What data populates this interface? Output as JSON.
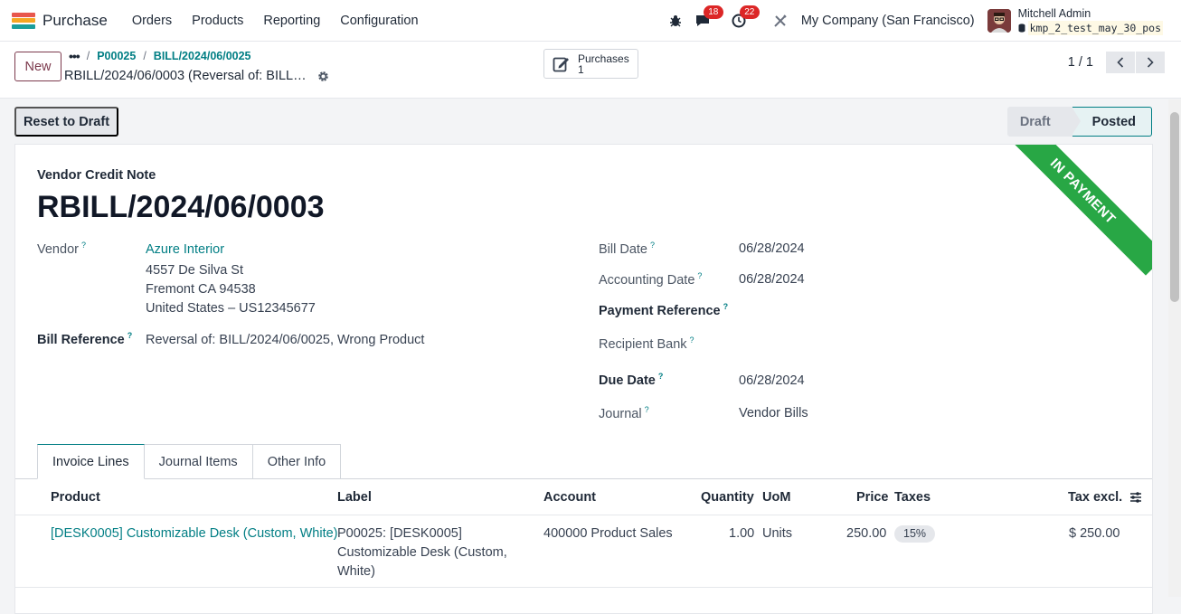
{
  "app": {
    "name": "Purchase",
    "logo_colors": [
      "#e8574d",
      "#f5a623",
      "#1a9e9b"
    ]
  },
  "menu": {
    "orders": "Orders",
    "products": "Products",
    "reporting": "Reporting",
    "configuration": "Configuration"
  },
  "systray": {
    "messages_count": "18",
    "activities_count": "22",
    "company": "My Company (San Francisco)",
    "user_name": "Mitchell Admin",
    "database": "kmp_2_test_may_30_pos"
  },
  "control_panel": {
    "new_label": "New",
    "breadcrumb": [
      "P00025",
      "BILL/2024/06/0025"
    ],
    "record_title": "RBILL/2024/06/0003 (Reversal of: BILL…",
    "smart_button": {
      "label": "Purchases",
      "count": "1"
    },
    "pager": "1 / 1"
  },
  "status": {
    "reset_label": "Reset to Draft",
    "stages": [
      "Draft",
      "Posted"
    ],
    "current": "Posted"
  },
  "form": {
    "ribbon": "IN PAYMENT",
    "doc_type": "Vendor Credit Note",
    "doc_name": "RBILL/2024/06/0003",
    "vendor_label": "Vendor",
    "vendor": "Azure Interior",
    "address": [
      "4557 De Silva St",
      "Fremont CA 94538",
      "United States – US12345677"
    ],
    "bill_reference_label": "Bill Reference",
    "bill_reference": "Reversal of: BILL/2024/06/0025, Wrong Product",
    "bill_date_label": "Bill Date",
    "bill_date": "06/28/2024",
    "accounting_date_label": "Accounting Date",
    "accounting_date": "06/28/2024",
    "payment_reference_label": "Payment Reference",
    "recipient_bank_label": "Recipient Bank",
    "due_date_label": "Due Date",
    "due_date": "06/28/2024",
    "journal_label": "Journal",
    "journal": "Vendor Bills",
    "help_mark": "?"
  },
  "tabs": [
    "Invoice Lines",
    "Journal Items",
    "Other Info"
  ],
  "lines": {
    "headers": {
      "product": "Product",
      "label": "Label",
      "account": "Account",
      "quantity": "Quantity",
      "uom": "UoM",
      "price": "Price",
      "taxes": "Taxes",
      "tax_excl": "Tax excl."
    },
    "rows": [
      {
        "product": "[DESK0005] Customizable Desk (Custom, White)",
        "label": [
          "P00025: [DESK0005]",
          "Customizable Desk (Custom,",
          "White)"
        ],
        "account": "400000 Product Sales",
        "quantity": "1.00",
        "uom": "Units",
        "price": "250.00",
        "tax": "15%",
        "subtotal": "$ 250.00"
      }
    ]
  },
  "colors": {
    "primary": "#7c3a4d",
    "link": "#017e84",
    "ribbon": "#28a745",
    "badge": "#dc2626"
  }
}
